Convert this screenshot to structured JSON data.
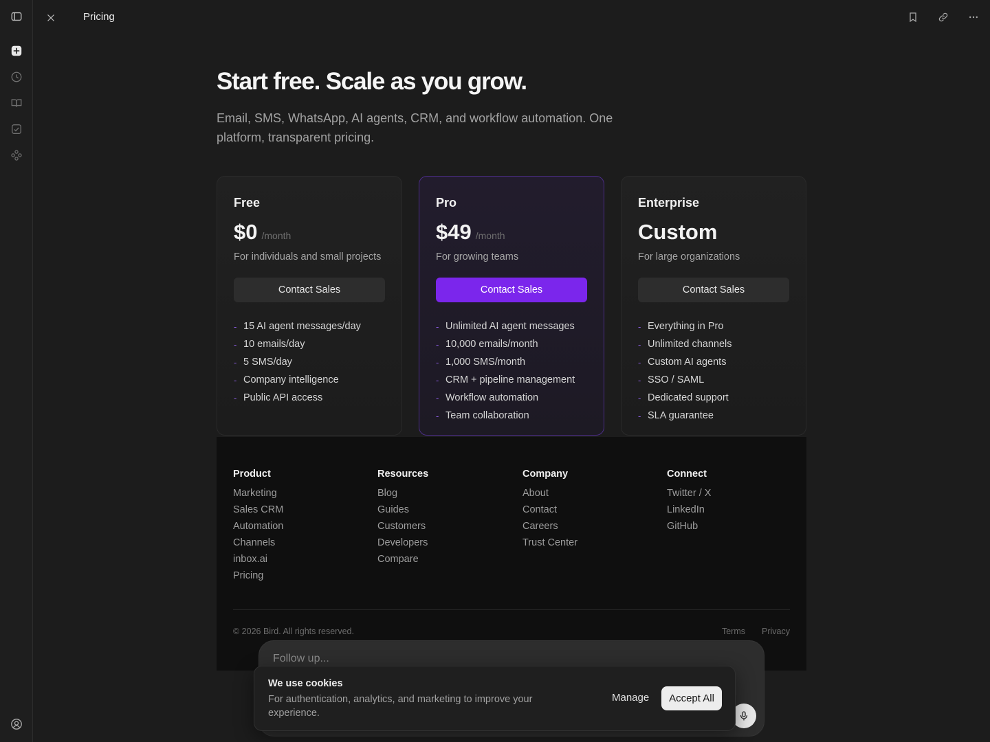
{
  "topbar": {
    "title": "Pricing",
    "icons": [
      "close-icon",
      "bookmark-icon",
      "link-icon",
      "more-icon"
    ]
  },
  "rail": {
    "icons": [
      "sidebar-toggle-icon",
      "new-thread-icon",
      "history-icon",
      "book-icon",
      "task-check-icon",
      "apps-icon",
      "account-icon"
    ]
  },
  "hero": {
    "title": "Start free. Scale as you grow.",
    "subtitle": "Email, SMS, WhatsApp, AI agents, CRM, and workflow automation. One platform, transparent pricing."
  },
  "plans": [
    {
      "name": "Free",
      "price": "$0",
      "period": "/month",
      "description": "For individuals and small projects",
      "cta": "Contact Sales",
      "features": [
        "15 AI agent messages/day",
        "10 emails/day",
        "5 SMS/day",
        "Company intelligence",
        "Public API access"
      ]
    },
    {
      "name": "Pro",
      "price": "$49",
      "period": "/month",
      "description": "For growing teams",
      "cta": "Contact Sales",
      "features": [
        "Unlimited AI agent messages",
        "10,000 emails/month",
        "1,000 SMS/month",
        "CRM + pipeline management",
        "Workflow automation",
        "Team collaboration"
      ]
    },
    {
      "name": "Enterprise",
      "price": "Custom",
      "period": "",
      "description": "For large organizations",
      "cta": "Contact Sales",
      "features": [
        "Everything in Pro",
        "Unlimited channels",
        "Custom AI agents",
        "SSO / SAML",
        "Dedicated support",
        "SLA guarantee"
      ]
    }
  ],
  "footer": {
    "columns": [
      {
        "heading": "Product",
        "links": [
          "Marketing",
          "Sales CRM",
          "Automation",
          "Channels",
          "inbox.ai",
          "Pricing"
        ]
      },
      {
        "heading": "Resources",
        "links": [
          "Blog",
          "Guides",
          "Customers",
          "Developers",
          "Compare"
        ]
      },
      {
        "heading": "Company",
        "links": [
          "About",
          "Contact",
          "Careers",
          "Trust Center"
        ]
      },
      {
        "heading": "Connect",
        "links": [
          "Twitter / X",
          "LinkedIn",
          "GitHub"
        ]
      }
    ],
    "copyright": "© 2026 Bird. All rights reserved.",
    "legal": [
      "Terms",
      "Privacy"
    ]
  },
  "composer": {
    "placeholder": "Follow up..."
  },
  "cookie": {
    "title": "We use cookies",
    "text": "For authentication, analytics, and marketing to improve your experience.",
    "manage": "Manage",
    "accept": "Accept All"
  },
  "colors": {
    "accent": "#7b26ec",
    "pro_border": "#4b2d86",
    "background": "#1c1c1c",
    "footer_bg": "#0f0f0f"
  }
}
